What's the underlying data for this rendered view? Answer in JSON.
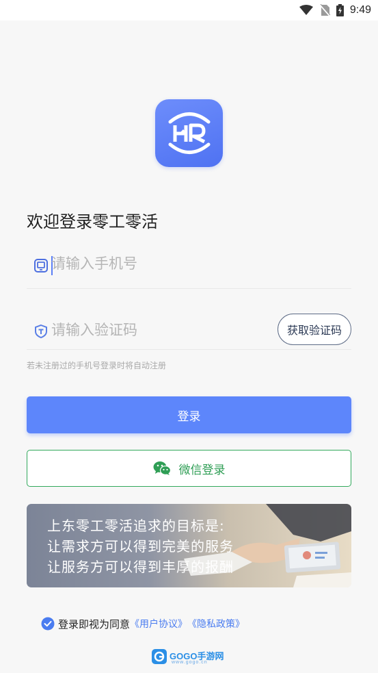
{
  "status_bar": {
    "time": "9:49",
    "icons": [
      "wifi-icon",
      "no-sim-icon",
      "battery-charging-icon"
    ]
  },
  "app": {
    "logo_icon": "hr-logo-icon",
    "welcome_title": "欢迎登录零工零活"
  },
  "form": {
    "phone_placeholder": "请输入手机号",
    "phone_icon": "phone-icon",
    "code_placeholder": "请输入验证码",
    "code_icon": "shield-icon",
    "get_code_label": "获取验证码",
    "hint": "若未注册过的手机号登录时将自动注册"
  },
  "buttons": {
    "login_label": "登录",
    "wechat_label": "微信登录",
    "wechat_icon": "wechat-icon"
  },
  "banner": {
    "line1": "上东零工零活追求的目标是:",
    "line2": "让需求方可以得到完美的服务",
    "line3": "让服务方可以得到丰厚的报酬"
  },
  "agreement": {
    "prefix": "登录即视为同意",
    "user_agreement": "《用户协议》",
    "privacy_policy": "《隐私政策》",
    "checked": true
  },
  "watermark": {
    "text": "GOGO手游网",
    "subtext": "www.gogo.cn"
  },
  "colors": {
    "primary": "#5d86fb",
    "wechat": "#31a85b",
    "link": "#4a7cf0"
  }
}
